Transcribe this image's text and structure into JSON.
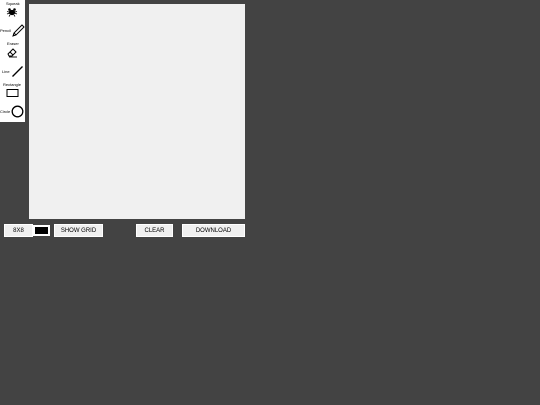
{
  "tools": {
    "squeak": {
      "label": "Squeak",
      "icon": "squeak-icon"
    },
    "pencil": {
      "label": "Pencil",
      "icon": "pencil-icon"
    },
    "eraser": {
      "label": "Eraser",
      "icon": "eraser-icon"
    },
    "line": {
      "label": "Line",
      "icon": "line-icon"
    },
    "rectangle": {
      "label": "Rectangle",
      "icon": "rectangle-icon"
    },
    "circle": {
      "label": "Circle",
      "icon": "circle-icon"
    }
  },
  "controls": {
    "size_label": "8X8",
    "color": "#000000",
    "show_grid_label": "SHOW GRID",
    "clear_label": "CLEAR",
    "download_label": "DOWNLOAD"
  },
  "colors": {
    "background": "#434343",
    "canvas": "#f0f0f0",
    "panel": "#ffffff"
  }
}
